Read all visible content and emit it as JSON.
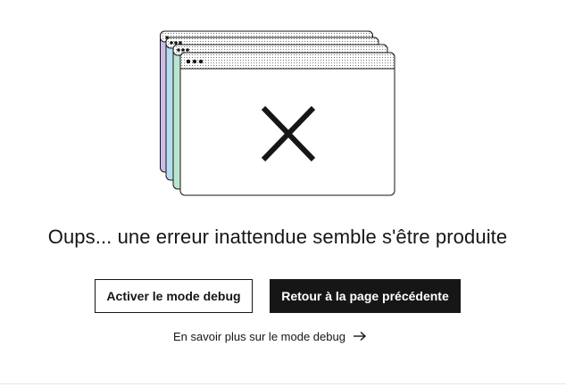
{
  "error": {
    "headline": "Oups... une erreur inattendue semble s'être produite",
    "illustration_icon": "stacked-browser-windows-error-icon"
  },
  "actions": {
    "debug_label": "Activer le mode debug",
    "back_label": "Retour à la page précédente"
  },
  "link": {
    "label": "En savoir plus sur le mode debug",
    "icon": "arrow-right-icon"
  },
  "colors": {
    "text": "#161616",
    "primary_bg": "#161616",
    "primary_text": "#ffffff",
    "window_purple": "#cdbde6",
    "window_blue": "#b7dcee",
    "window_green": "#b9e5cf",
    "window_front": "#ffffff"
  }
}
